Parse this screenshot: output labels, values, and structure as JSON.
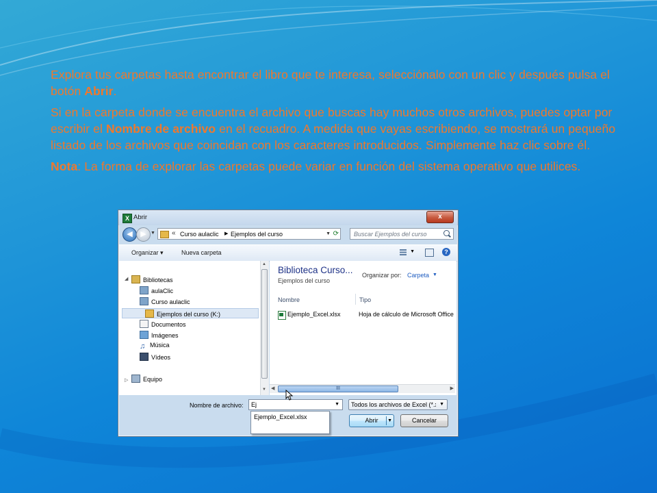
{
  "instructions": {
    "p1_a": "Explora tus carpetas hasta encontrar el libro que te interesa, selecciónalo con un clic y después pulsa el botón ",
    "p1_bold": "Abrir",
    "p1_b": ".",
    "p2_a": "Si en la carpeta donde se encuentra el archivo que buscas hay muchos otros archivos, puedes optar por escribir el ",
    "p2_bold": "Nombre de archivo",
    "p2_b": " en el recuadro. A medida que vayas escribiendo, se mostrará un pequeño listado de los archivos que coincidan con los caracteres introducidos. Simplemente haz clic sobre él.",
    "p3_bold": "Nota",
    "p3_a": ": La forma de explorar las carpetas puede variar en función del sistema operativo que utilices."
  },
  "dialog": {
    "title": "Abrir",
    "app_icon": "excel-icon",
    "close_symbol": "x",
    "address": {
      "separator": "«",
      "crumbs": [
        "Curso aulaclic",
        "Ejemplos del curso"
      ]
    },
    "search_placeholder": "Buscar Ejemplos del curso",
    "commands": {
      "organize": "Organizar ▾",
      "new_folder": "Nueva carpeta"
    },
    "tree": [
      {
        "label": "Bibliotecas",
        "icon": "library-icon"
      },
      {
        "label": "aulaClic",
        "icon": "library-icon"
      },
      {
        "label": "Curso aulaclic",
        "icon": "library-icon"
      },
      {
        "label": "Ejemplos del curso (K:)",
        "icon": "folder-icon",
        "selected": true
      },
      {
        "label": "Documentos",
        "icon": "documents-icon"
      },
      {
        "label": "Imágenes",
        "icon": "pictures-icon"
      },
      {
        "label": "Música",
        "icon": "music-icon"
      },
      {
        "label": "Vídeos",
        "icon": "videos-icon"
      },
      {
        "label": "Equipo",
        "icon": "computer-icon"
      }
    ],
    "library": {
      "title": "Biblioteca Curso...",
      "subtitle": "Ejemplos del curso",
      "arrange_label": "Organizar por:",
      "arrange_value": "Carpeta"
    },
    "columns": {
      "name": "Nombre",
      "type": "Tipo"
    },
    "files": [
      {
        "name": "Ejemplo_Excel.xlsx",
        "type": "Hoja de cálculo de Microsoft Office"
      }
    ],
    "filename_label": "Nombre de archivo:",
    "filename_value": "Ej",
    "autocomplete": [
      "Ejemplo_Excel.xlsx"
    ],
    "filter_value": "Todos los archivos de Excel (*.x",
    "open_label": "Abrir",
    "cancel_label": "Cancelar",
    "scroll_grip": "III"
  }
}
